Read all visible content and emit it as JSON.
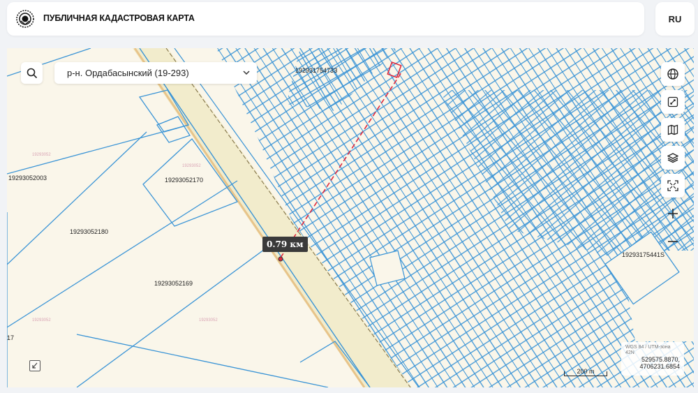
{
  "header": {
    "title": "ПУБЛИЧНАЯ КАДАСТРОВАЯ КАРТА",
    "lang": "RU",
    "logo_icon": "kazakhstan-emblem-icon"
  },
  "map": {
    "district_select": "р-н. Ордабасынский (19-293)",
    "measurement_label": "0.79 км",
    "parcel_labels": [
      "19293175473З",
      "19293052003",
      "19293052170",
      "19293052180",
      "19293052169",
      "19293175441S",
      "17"
    ],
    "faint_labels": [
      "19293052",
      "19293052",
      "19293052",
      "19293052"
    ],
    "coords": {
      "system": "WGS 84 / UTM-зона 42N",
      "x": "529575.8870,",
      "y": "4706231.6854"
    },
    "scale_label": "200 m",
    "colors": {
      "parcel_line": "#3a94d6",
      "background": "#faf6ea",
      "road": "#f2eccc",
      "road_edge": "#e8c48a",
      "measure_line": "#e0283c"
    }
  },
  "toolbar": {
    "icons": [
      "globe-icon",
      "fullscreen-icon",
      "map-icon",
      "layers-icon",
      "fit-extent-icon",
      "zoom-in-icon",
      "zoom-out-icon"
    ]
  }
}
